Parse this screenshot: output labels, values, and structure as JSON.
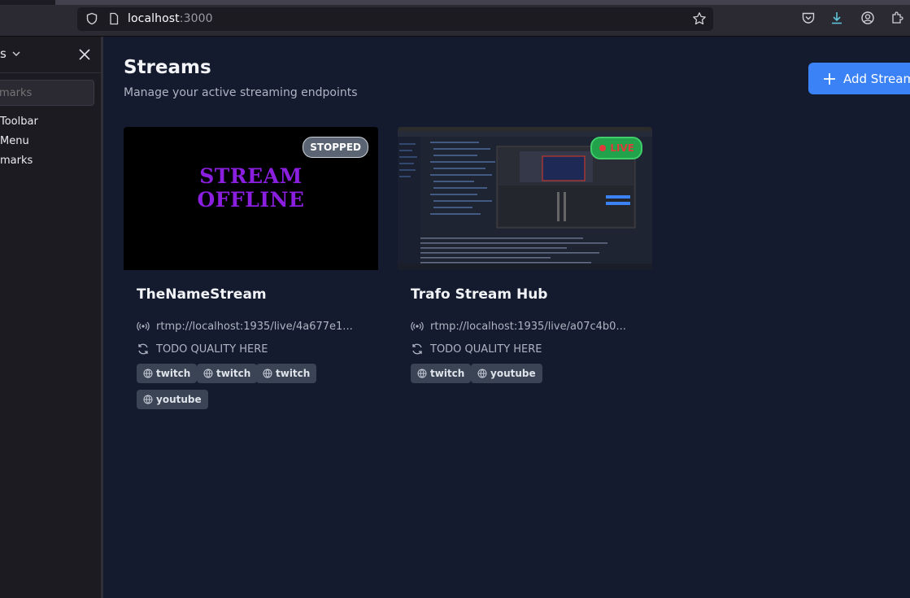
{
  "browser": {
    "url_host": "localhost",
    "url_port": ":3000"
  },
  "sidebar": {
    "title": "s",
    "search_placeholder": "marks",
    "items": [
      {
        "label": "Toolbar"
      },
      {
        "label": "Menu"
      },
      {
        "label": "marks"
      }
    ]
  },
  "main": {
    "title": "Streams",
    "subtitle": "Manage your active streaming endpoints",
    "add_button_label": "Add Stream"
  },
  "streams": [
    {
      "name": "TheNameStream",
      "status": "STOPPED",
      "thumbnail_text_1": "STREAM",
      "thumbnail_text_2": "OFFLINE",
      "url": "rtmp://localhost:1935/live/4a677e1...",
      "quality": "TODO QUALITY HERE",
      "platforms": [
        "twitch",
        "twitch",
        "twitch",
        "youtube"
      ]
    },
    {
      "name": "Trafo Stream Hub",
      "status": "LIVE",
      "url": "rtmp://localhost:1935/live/a07c4b0...",
      "quality": "TODO QUALITY HERE",
      "platforms": [
        "twitch",
        "youtube"
      ]
    }
  ],
  "colors": {
    "background": "#151b2e",
    "accent": "#3b82f6",
    "live": "#22a24a",
    "stopped": "#5b6472"
  }
}
